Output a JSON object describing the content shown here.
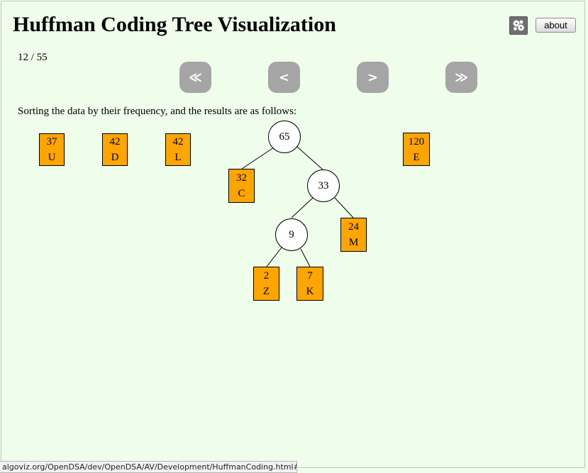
{
  "header": {
    "title": "Huffman Coding Tree Visualization",
    "about_label": "about",
    "settings_icon": "gear-icon"
  },
  "slideshow": {
    "counter": "12 / 55",
    "nav": {
      "first": "≪",
      "prev": "<",
      "next": ">",
      "last": "≫"
    },
    "message": "Sorting the data by their frequency, and the results are as follows:"
  },
  "tree": {
    "leaves": [
      {
        "weight": "37",
        "letter": "U"
      },
      {
        "weight": "42",
        "letter": "D"
      },
      {
        "weight": "42",
        "letter": "L"
      },
      {
        "weight": "32",
        "letter": "C"
      },
      {
        "weight": "24",
        "letter": "M"
      },
      {
        "weight": "2",
        "letter": "Z"
      },
      {
        "weight": "7",
        "letter": "K"
      },
      {
        "weight": "120",
        "letter": "E"
      }
    ],
    "internal": [
      {
        "weight": "65"
      },
      {
        "weight": "33"
      },
      {
        "weight": "9"
      }
    ],
    "colors": {
      "leaf_fill": "#ffa500",
      "node_fill": "#ffffff",
      "background": "#eefeeb"
    }
  },
  "statusbar": {
    "url": "algoviz.org/OpenDSA/dev/OpenDSA/AV/Development/HuffmanCoding.html#"
  }
}
